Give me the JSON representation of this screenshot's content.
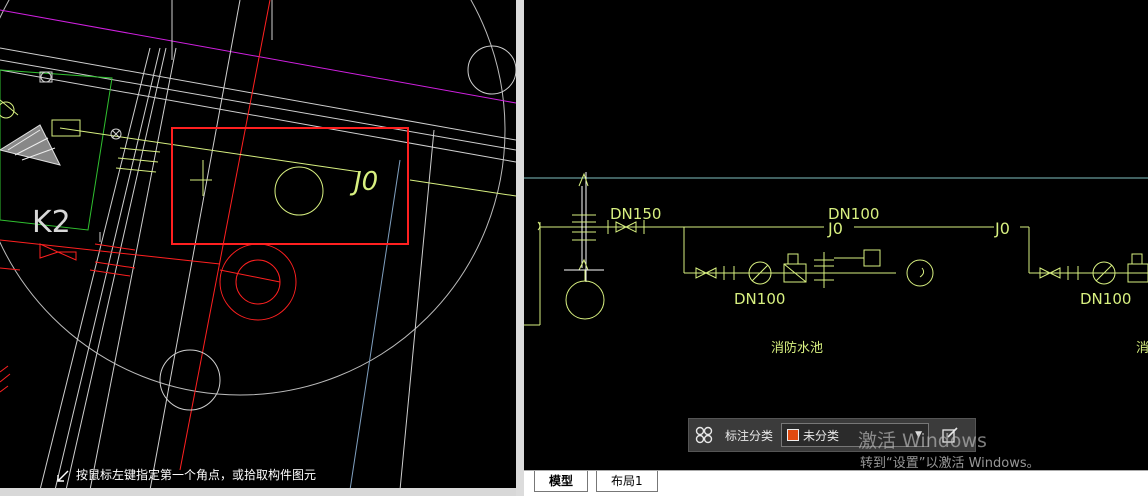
{
  "left_view": {
    "label_k2": "K2",
    "label_j0": "J0",
    "prompt": "按鼠标左键指定第一个角点，或拾取构件图元"
  },
  "right_view": {
    "label_dn150": "DN150",
    "label_dn100_top": "DN100",
    "label_j0_mid": "J0",
    "label_j0_right": "J0",
    "label_dn100_left": "DN100",
    "label_dn100_right": "DN100",
    "label_pool": "消防水池",
    "label_partial": "消"
  },
  "toolbar": {
    "icon": "grid-icon",
    "label": "标注分类",
    "select_value": "未分类",
    "swatch_color": "#e04a10"
  },
  "watermark": {
    "line1": "激活 Windows",
    "line2": "转到“设置”以激活 Windows。"
  },
  "tabs": [
    {
      "label": "模型"
    },
    {
      "label": "布局1"
    }
  ],
  "colors": {
    "highlight_box": "#ff2020",
    "cad_yellow_green": "#d8f080",
    "cad_magenta": "#d020e0",
    "cad_red": "#ff2020",
    "cad_green": "#30c030",
    "cad_cyan": "#80c0c0"
  }
}
